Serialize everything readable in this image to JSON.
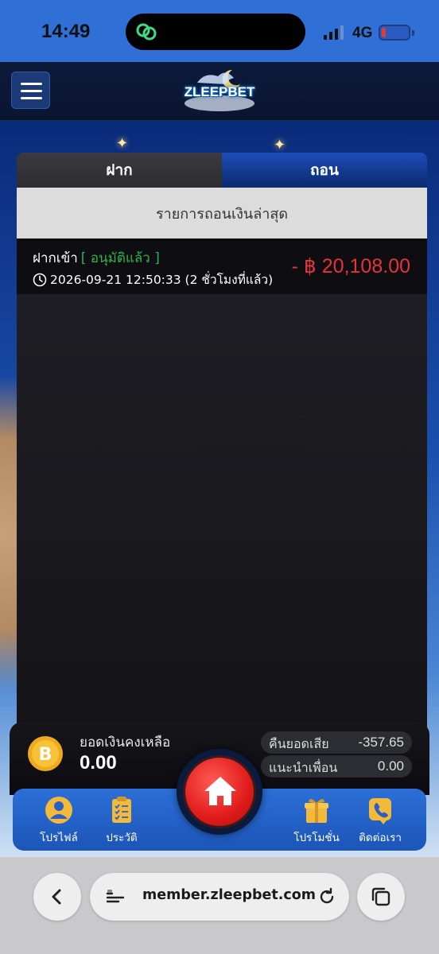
{
  "status_bar": {
    "time": "14:49",
    "network": "4G"
  },
  "header": {
    "logo_text": "ZLEEPBET"
  },
  "tabs": [
    {
      "label": "ฝาก",
      "active": false
    },
    {
      "label": "ถอน",
      "active": true
    }
  ],
  "list": {
    "title": "รายการถอนเงินล่าสุด",
    "transactions": [
      {
        "type": "ฝากเข้า",
        "status": "[ อนุมัติแล้ว ]",
        "time": "2026-09-21 12:50:33 (2 ชั่วโมงที่แล้ว)",
        "amount": "- ฿ 20,108.00"
      }
    ]
  },
  "wallet": {
    "balance_label": "ยอดเงินคงเหลือ",
    "balance_value": "0.00",
    "cashback_label": "คืนยอดเสีย",
    "cashback_value": "-357.65",
    "referral_label": "แนะนำเพื่อน",
    "referral_value": "0.00"
  },
  "bottom_nav": {
    "profile": "โปรไฟล์",
    "history": "ประวัติ",
    "promotion": "โปรโมชั่น",
    "contact": "ติดต่อเรา"
  },
  "browser": {
    "url": "member.zleepbet.com"
  },
  "colors": {
    "accent_blue": "#2f6fd6",
    "status_approved": "#2fb34f",
    "amount_negative": "#e5323c",
    "home_red": "#e01b1b"
  }
}
